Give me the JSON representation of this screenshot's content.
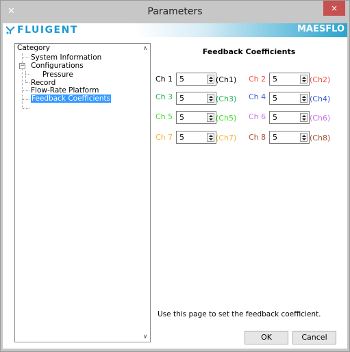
{
  "window": {
    "title": "Parameters",
    "close_label": "×",
    "settings_icon": "tools-icon"
  },
  "brand": {
    "logo_text": "FLUIGENT",
    "product": "MAESFLO",
    "logo_color": "#1a9ad0"
  },
  "tree": {
    "header": "Category",
    "items": [
      {
        "label": "System Information"
      },
      {
        "label": "Configurations",
        "expander": "−"
      },
      {
        "label": "Pressure"
      },
      {
        "label": "Record"
      },
      {
        "label": "Flow-Rate Platform"
      },
      {
        "label": "Feedback Coefficients",
        "selected": true
      }
    ]
  },
  "panel": {
    "title": "Feedback Coefficients",
    "hint": "Use this page to set the feedback coefficient.",
    "channels": [
      {
        "label": "Ch 1",
        "value": "5",
        "ref": "(Ch1)",
        "color": "#000000"
      },
      {
        "label": "Ch 2",
        "value": "5",
        "ref": "(Ch2)",
        "color": "#ff4a3d"
      },
      {
        "label": "Ch 3",
        "value": "5",
        "ref": "(Ch3)",
        "color": "#22b14c"
      },
      {
        "label": "Ch 4",
        "value": "5",
        "ref": "(Ch4)",
        "color": "#3f5bd6"
      },
      {
        "label": "Ch 5",
        "value": "5",
        "ref": "(Ch5)",
        "color": "#3ddc2a"
      },
      {
        "label": "Ch 6",
        "value": "5",
        "ref": "(Ch6)",
        "color": "#c873e8"
      },
      {
        "label": "Ch 7",
        "value": "5",
        "ref": "(Ch7)",
        "color": "#f5b13d"
      },
      {
        "label": "Ch 8",
        "value": "5",
        "ref": "(Ch8)",
        "color": "#a0522d"
      }
    ]
  },
  "buttons": {
    "ok": "OK",
    "cancel": "Cancel"
  }
}
